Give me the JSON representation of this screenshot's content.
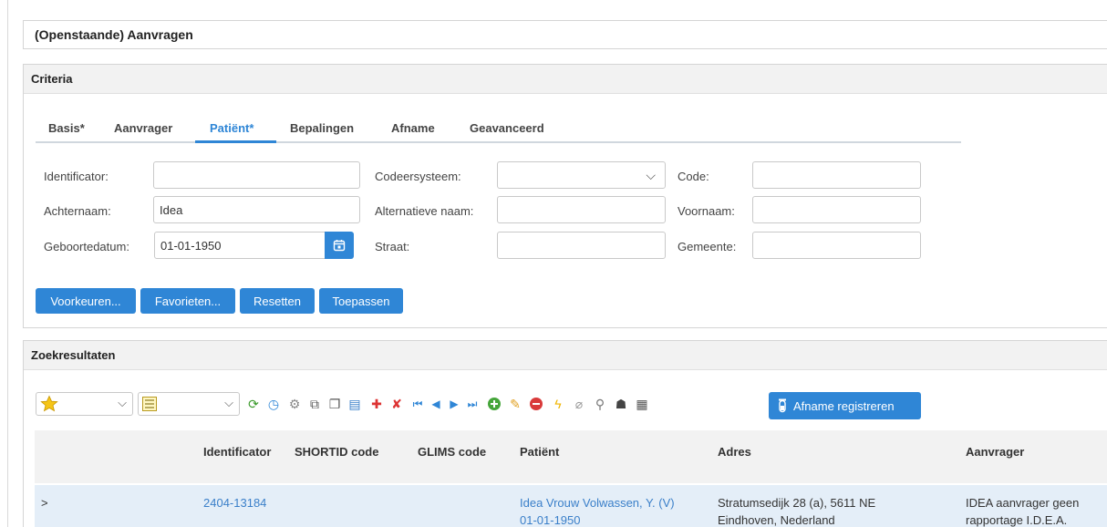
{
  "page": {
    "title": "(Openstaande) Aanvragen"
  },
  "criteria": {
    "title": "Criteria",
    "tabs": [
      "Basis*",
      "Aanvrager",
      "Patiënt*",
      "Bepalingen",
      "Afname",
      "Geavanceerd"
    ],
    "active_tab": "Patiënt*",
    "fields": {
      "identificator": {
        "label": "Identificator:",
        "value": ""
      },
      "codeersysteem": {
        "label": "Codeersysteem:",
        "value": ""
      },
      "code": {
        "label": "Code:",
        "value": ""
      },
      "achternaam": {
        "label": "Achternaam:",
        "value": "Idea"
      },
      "alternatieve_naam": {
        "label": "Alternatieve naam:",
        "value": ""
      },
      "voornaam": {
        "label": "Voornaam:",
        "value": ""
      },
      "geboortedatum": {
        "label": "Geboortedatum:",
        "value": "01-01-1950"
      },
      "straat": {
        "label": "Straat:",
        "value": ""
      },
      "gemeente": {
        "label": "Gemeente:",
        "value": ""
      }
    },
    "buttons": {
      "voorkeuren": "Voorkeuren...",
      "favorieten": "Favorieten...",
      "resetten": "Resetten",
      "toepassen": "Toepassen"
    }
  },
  "results": {
    "title": "Zoekresultaten",
    "toolbar": {
      "afname_label": "Afname registreren",
      "icons": [
        "refresh-icon",
        "clock-refresh-icon",
        "settings-gear-icon",
        "copy-check-icon",
        "copy-icon",
        "save-list-icon",
        "pin-red-icon",
        "unpin-red-icon",
        "first-page-icon",
        "previous-page-icon",
        "next-page-icon",
        "last-page-icon",
        "add-icon",
        "edit-icon",
        "remove-icon",
        "lightning-icon",
        "attachment-icon",
        "search-attachment-icon",
        "ghost-icon",
        "export-icon"
      ]
    },
    "columns": [
      "Identificator",
      "SHORTID code",
      "GLIMS code",
      "Patiënt",
      "Adres",
      "Aanvrager"
    ],
    "rows": [
      {
        "expander": ">",
        "identificator": "2404-13184",
        "shortid": "",
        "glims": "",
        "patient_line1": "Idea Vrouw Volwassen, Y. (V)",
        "patient_line2": "01-01-1950",
        "adres_line1": "Stratumsedijk 28 (a), 5611 NE",
        "adres_line2": "Eindhoven, Nederland",
        "aanvrager_line1": "IDEA aanvrager geen",
        "aanvrager_line2": "rapportage I.D.E.A."
      }
    ]
  }
}
